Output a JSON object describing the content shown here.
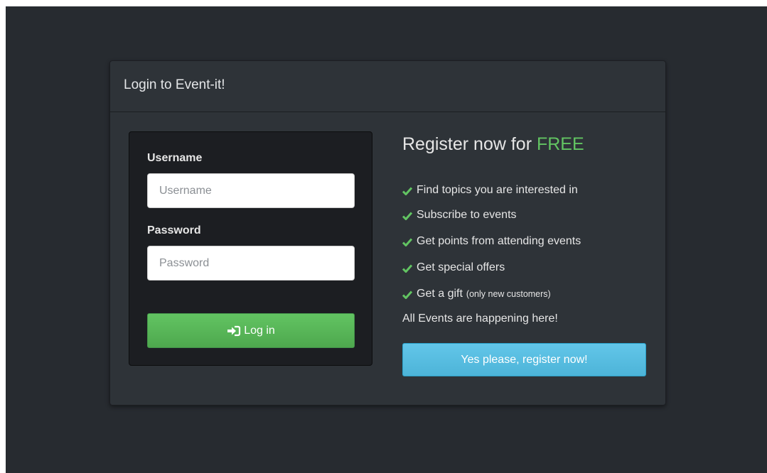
{
  "panel": {
    "title": "Login to Event-it!"
  },
  "login": {
    "username_label": "Username",
    "username_placeholder": "Username",
    "password_label": "Password",
    "password_placeholder": "Password",
    "login_button": "Log in",
    "login_icon": "log-in-icon"
  },
  "register": {
    "title_prefix": "Register now for",
    "title_highlight": "FREE",
    "benefits": [
      {
        "text": "Find topics you are interested in",
        "note": ""
      },
      {
        "text": "Subscribe to events",
        "note": ""
      },
      {
        "text": "Get points from attending events",
        "note": ""
      },
      {
        "text": "Get special offers",
        "note": ""
      },
      {
        "text": "Get a gift",
        "note": "(only new customers)"
      }
    ],
    "check_icon": "check-icon",
    "tagline": "All Events are happening here!",
    "button": "Yes please, register now!"
  },
  "colors": {
    "page_background": "#272b30",
    "panel_background": "#2e3338",
    "login_box_background": "#1c1e22",
    "success_green": "#62c462",
    "info_blue": "#5bc0de"
  }
}
